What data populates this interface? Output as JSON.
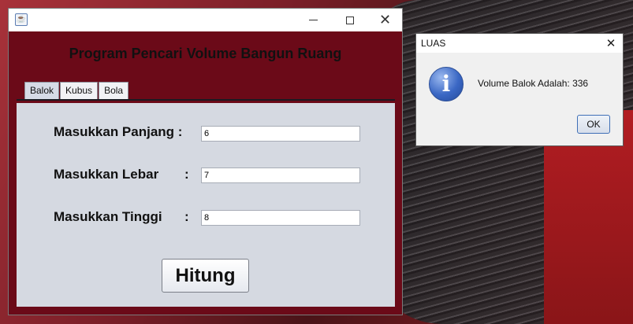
{
  "main_window": {
    "app_icon": "java-cup-icon",
    "close_glyph": "✕"
  },
  "app": {
    "title": "Program Pencari Volume Bangun Ruang"
  },
  "tabs": [
    {
      "label": "Balok",
      "active": true
    },
    {
      "label": "Kubus",
      "active": false
    },
    {
      "label": "Bola",
      "active": false
    }
  ],
  "form": {
    "panjang": {
      "label": "Masukkan Panjang :",
      "value": "6"
    },
    "lebar": {
      "label": "Masukkan Lebar",
      "colon": ":",
      "value": "7"
    },
    "tinggi": {
      "label": "Masukkan Tinggi",
      "colon": ":",
      "value": "8"
    },
    "submit_label": "Hitung"
  },
  "dialog": {
    "title": "LUAS",
    "close_glyph": "✕",
    "icon": "information-icon",
    "icon_glyph": "i",
    "message": "Volume Balok Adalah: 336",
    "ok_label": "OK"
  },
  "colors": {
    "content_background": "#6b0a18",
    "panel_background": "#d5d9e1",
    "info_icon": "#3a67c4"
  }
}
